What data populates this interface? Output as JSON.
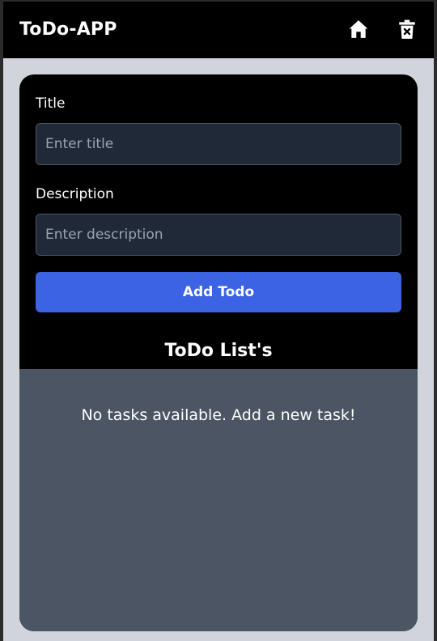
{
  "header": {
    "brand": "ToDo-APP",
    "icons": [
      "home-icon",
      "trash-icon"
    ]
  },
  "form": {
    "title_label": "Title",
    "title_placeholder": "Enter title",
    "title_value": "",
    "description_label": "Description",
    "description_placeholder": "Enter description",
    "description_value": "",
    "add_button_label": "Add Todo"
  },
  "list": {
    "heading": "ToDo List's",
    "empty_message": "No tasks available. Add a new task!"
  },
  "colors": {
    "page_bg": "#d1d5db",
    "nav_bg": "#000000",
    "card_bg": "#000000",
    "input_bg": "#1f2937",
    "button_bg": "#3b63e4",
    "list_bg": "#4b5563"
  }
}
